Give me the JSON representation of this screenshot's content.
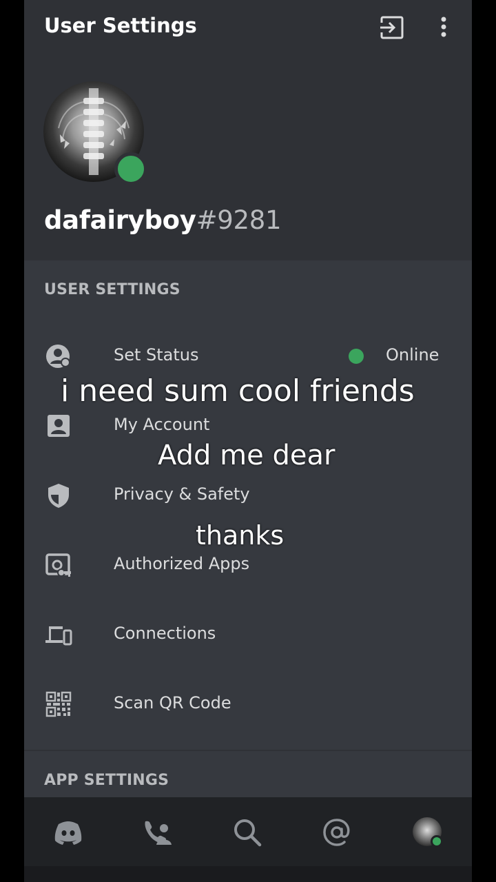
{
  "header": {
    "title": "User Settings"
  },
  "profile": {
    "username": "dafairyboy",
    "discriminator": "#9281"
  },
  "user_settings": {
    "section_label": "USER SETTINGS",
    "items": [
      {
        "label": "Set Status",
        "value": "Online",
        "icon": "status-icon"
      },
      {
        "label": "My Account",
        "icon": "account-icon"
      },
      {
        "label": "Privacy & Safety",
        "icon": "shield-icon"
      },
      {
        "label": "Authorized Apps",
        "icon": "authorized-apps-icon"
      },
      {
        "label": "Connections",
        "icon": "devices-icon"
      },
      {
        "label": "Scan QR Code",
        "icon": "qr-code-icon"
      }
    ]
  },
  "app_settings": {
    "section_label": "APP SETTINGS"
  },
  "overlay_text": {
    "line1": "i need sum cool friends",
    "line2": "Add me dear",
    "line3": "thanks"
  },
  "colors": {
    "background": "#36393f",
    "header_bg": "#2f3136",
    "online": "#3ba55d",
    "tabbar_bg": "#202225"
  },
  "tabbar": {
    "tabs": [
      "home-icon",
      "friends-icon",
      "search-icon",
      "mentions-icon",
      "profile-avatar"
    ]
  }
}
